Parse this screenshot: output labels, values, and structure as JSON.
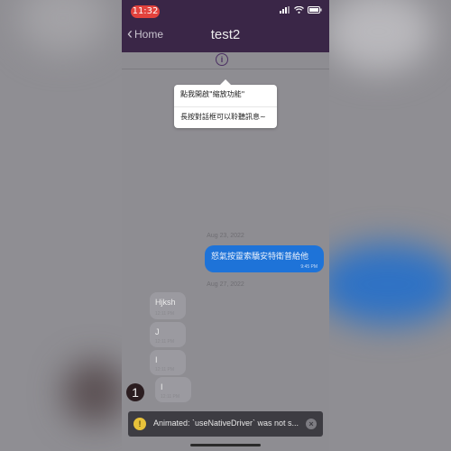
{
  "status_bar": {
    "time": "11:32"
  },
  "nav": {
    "back_label": "Home",
    "title": "test2"
  },
  "popover": {
    "items": [
      "點我開啟\"縮放功能\"",
      "長按對話框可以聆聽訊息~"
    ]
  },
  "messages": {
    "date_1": "Aug 23, 2022",
    "outgoing": {
      "text": "怒氣按靈索驕安特衛普給他",
      "time": "9:45 PM"
    },
    "date_2": "Aug 27, 2022",
    "incoming": [
      {
        "text": "Hjksh",
        "time": "12:11 PM"
      },
      {
        "text": "J",
        "time": "12:11 PM"
      },
      {
        "text": "I",
        "time": "12:11 PM"
      },
      {
        "text": "I",
        "time": "12:11 PM"
      }
    ]
  },
  "badge": {
    "count": "1"
  },
  "toast": {
    "message": "Animated: `useNativeDriver` was not s..."
  },
  "colors": {
    "header": "#3a2647",
    "outgoing_bubble": "#1e73d8",
    "time_pill": "#e2423d",
    "warning": "#e8c23a"
  }
}
